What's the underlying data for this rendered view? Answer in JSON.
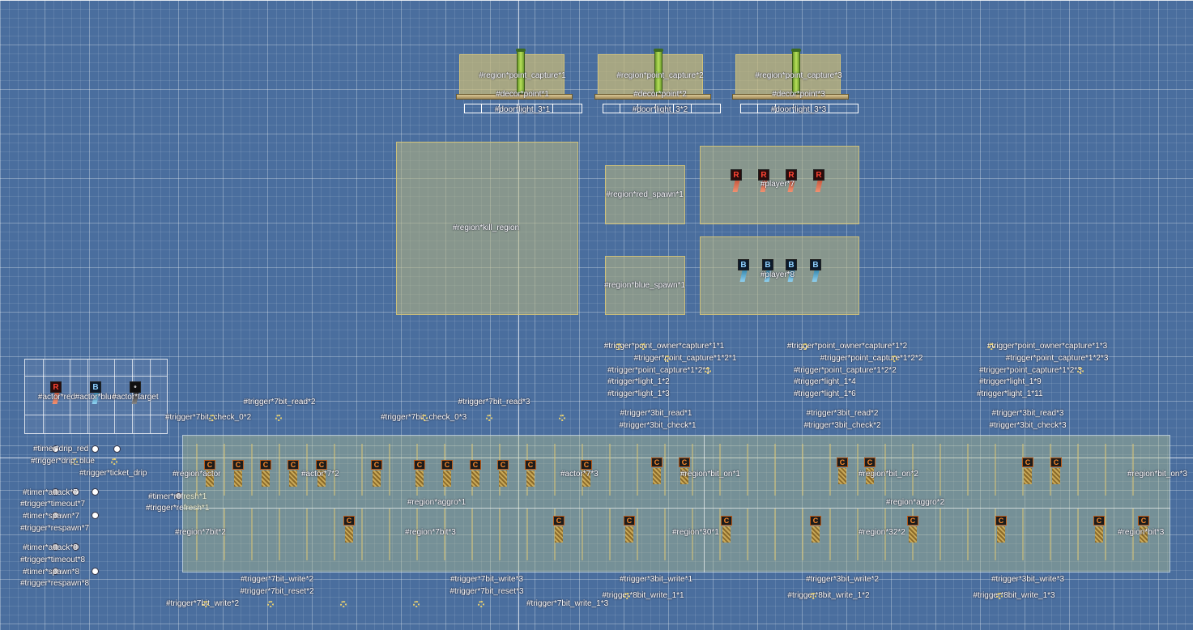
{
  "top": {
    "cap1": "#region*point_capture*1",
    "cap2": "#region*point_capture*2",
    "cap3": "#region*point_capture*3",
    "decor1": "#decor*point*1",
    "decor2": "#decor*point*2",
    "decor3": "#decor*point*3",
    "door1": "#door*light_3*1",
    "door2": "#door*light_3*2",
    "door3": "#door*light_3*3"
  },
  "middle": {
    "kill": "#region*kill_region",
    "red_spawn": "#region*red_spawn*1",
    "blue_spawn": "#region*blue_spawn*1",
    "player7": "#player*7",
    "player8": "#player*8"
  },
  "actors": {
    "red": "#actor*red",
    "blue": "#actor*blue",
    "target": "#actor*target"
  },
  "trig_top": {
    "poc1": "#trigger*point_owner*capture*1*1",
    "poc2": "#trigger*point_owner*capture*1*2",
    "poc3": "#trigger*point_owner*capture*1*3",
    "po1": "#trigger*point_capture*1*2*1",
    "po2": "#trigger*point_capture*1*2*2",
    "po3": "#trigger*point_capture*1*2*3",
    "l12": "#trigger*light_1*2",
    "l13": "#trigger*light_1*3",
    "l14": "#trigger*light_1*4",
    "l16": "#trigger*light_1*6",
    "l19": "#trigger*light_1*9",
    "l111": "#trigger*light_1*11",
    "r31": "#trigger*3bit_read*1",
    "r32": "#trigger*3bit_read*2",
    "r33": "#trigger*3bit_read*3",
    "c31": "#trigger*3bit_check*1",
    "c32": "#trigger*3bit_check*2",
    "c33": "#trigger*3bit_check*3",
    "r72": "#trigger*7bit_read*2",
    "r73": "#trigger*7bit_read*3",
    "row_left": "#trigger*7bit_check_0*2",
    "row_mid": "#trigger*7bit_check_0*3"
  },
  "left_timers": {
    "t1": "#timer*drip_red",
    "t2": "#trigger*drip_blue",
    "t3": "#trigger*ticket_drip",
    "t4": "#timer*attack*7",
    "t5": "#trigger*timeout*7",
    "t6": "#timer*spawn*7",
    "t7": "#trigger*respawn*7",
    "t8": "#timer*attack*8",
    "t9": "#trigger*timeout*8",
    "t10": "#timer*spawn*8",
    "t11": "#trigger*respawn*8",
    "refresh_timer": "#timer*refresh*1",
    "refresh_trigger": "#trigger*refresh*1"
  },
  "bottom": {
    "aggro1": "#region*aggro*1",
    "aggro2": "#region*aggro*2",
    "row1_left": "#region*actor",
    "row1_a": "#actor*7*2",
    "row1_b": "#actor*7*3",
    "row1_bit": "#region*bit_on*1",
    "row1_bit2": "#region*bit_on*2",
    "row1_bit3": "#region*bit_on*3",
    "row1_end": "#region*bit_on*3",
    "row2_left": "#region*7bit*2",
    "row2_mid": "#region*7bit*3",
    "row2_30": "#region*30*1",
    "row2_32": "#region*32*2",
    "row2_end": "#region*bit*3",
    "w72": "#trigger*7bit_write*2",
    "w73": "#trigger*7bit_write*3",
    "w31": "#trigger*3bit_write*1",
    "w32": "#trigger*3bit_write*2",
    "w33": "#trigger*3bit_write*3",
    "rs72": "#trigger*7bit_reset*2",
    "rs73": "#trigger*7bit_reset*3",
    "bw1": "#trigger*8bit_write_1*1",
    "bw2": "#trigger*8bit_write_1*2",
    "bw3": "#trigger*8bit_write_1*3",
    "row_left": "#trigger*7bit_write*2",
    "row_mid": "#trigger*7bit_write_1*3"
  },
  "colors": {
    "background": "#4a6e9e",
    "region_fill": "#bab880",
    "capture_stat": "#b7e05a",
    "red_team": "#ff4433",
    "blue_team": "#8fd0ff",
    "tile_icon": "#ff8a2a"
  }
}
